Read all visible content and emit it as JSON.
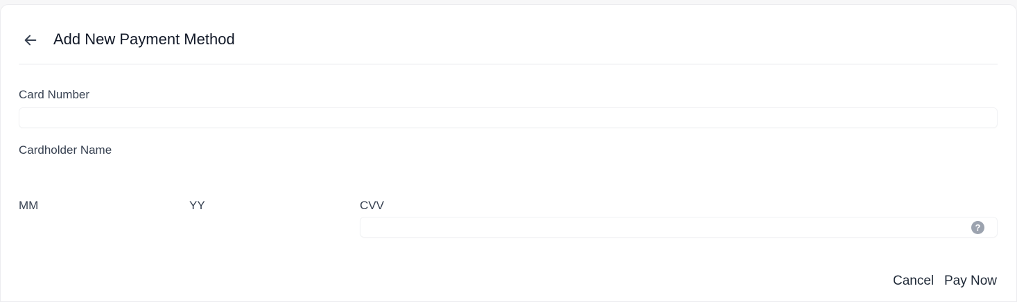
{
  "header": {
    "title": "Add New Payment Method",
    "back_icon": "arrow-left-icon"
  },
  "form": {
    "card_number": {
      "label": "Card Number",
      "value": "",
      "placeholder": ""
    },
    "cardholder_name": {
      "label": "Cardholder Name",
      "value": "",
      "placeholder": ""
    },
    "month": {
      "label": "MM",
      "value": ""
    },
    "year": {
      "label": "YY",
      "value": ""
    },
    "cvv": {
      "label": "CVV",
      "value": "",
      "help_icon": "question-circle-icon",
      "help_glyph": "?"
    }
  },
  "actions": {
    "cancel_label": "Cancel",
    "pay_label": "Pay Now"
  }
}
